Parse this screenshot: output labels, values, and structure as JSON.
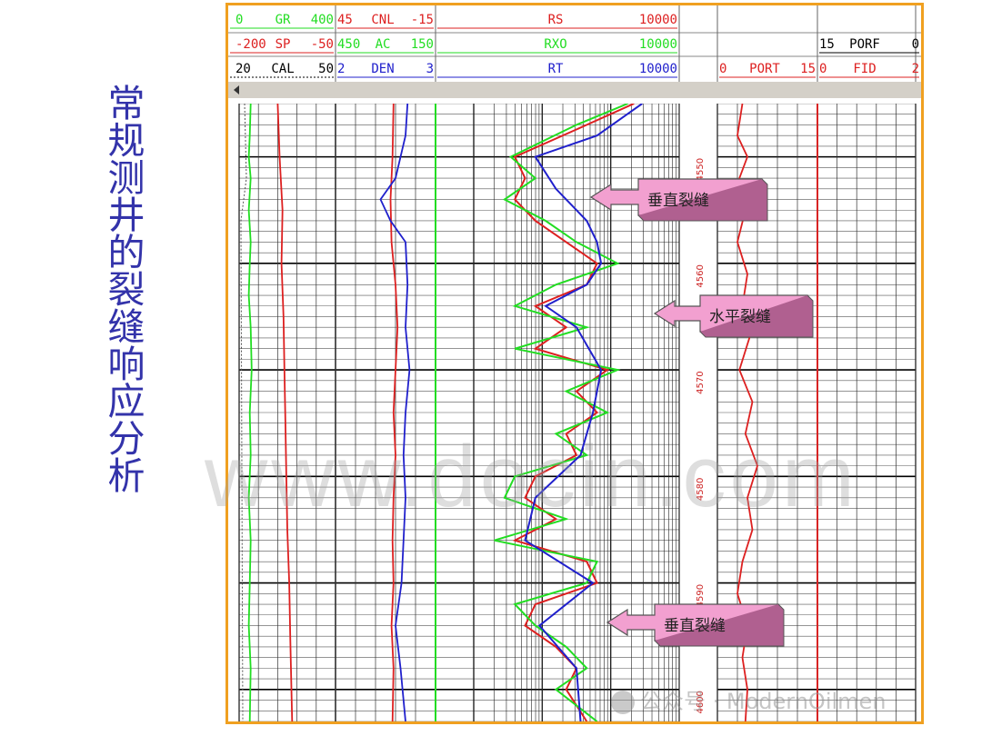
{
  "page_title": "常规测井的裂缝响应分析",
  "watermark": "www.docin.com",
  "credit": "公众号 · ModernOilmen",
  "annotations": [
    {
      "text": "垂直裂缝",
      "depth": 4554
    },
    {
      "text": "水平裂缝",
      "depth": 4565
    },
    {
      "text": "垂直裂缝",
      "depth": 4594
    }
  ],
  "colors": {
    "red": "#dd2020",
    "green": "#22dd22",
    "blue": "#2020cc",
    "frame": "#f0a020",
    "callout_fill": "#f2a0d0",
    "title": "#3333aa"
  },
  "chart_data": {
    "type": "line",
    "depth_range": [
      4545,
      4603
    ],
    "depth_ticks": [
      "4550",
      "4560",
      "4570",
      "4580",
      "4590",
      "4600"
    ],
    "header": {
      "track1": [
        {
          "left": "0",
          "name": "GR",
          "right": "400",
          "color": "#22dd22"
        },
        {
          "left": "-200",
          "name": "SP",
          "right": "-50",
          "color": "#dd2020"
        },
        {
          "left": "20",
          "name": "CAL",
          "right": "50",
          "color": "#000000"
        }
      ],
      "track2": [
        {
          "left": "45",
          "name": "CNL",
          "right": "-15",
          "color": "#dd2020"
        },
        {
          "left": "450",
          "name": "AC",
          "right": "150",
          "color": "#22dd22"
        },
        {
          "left": "2",
          "name": "DEN",
          "right": "3",
          "color": "#2020cc"
        }
      ],
      "track3": [
        {
          "left": "",
          "name": "RS",
          "right": "10000",
          "color": "#dd2020"
        },
        {
          "left": "",
          "name": "RXO",
          "right": "10000",
          "color": "#22dd22"
        },
        {
          "left": "",
          "name": "RT",
          "right": "10000",
          "color": "#2020cc"
        }
      ],
      "track4": [
        {
          "left": "0",
          "name": "PORT",
          "right": "15",
          "color": "#dd2020"
        }
      ],
      "track5": [
        {
          "left": "15",
          "name": "PORF",
          "right": "0",
          "color": "#000000"
        },
        {
          "left": "0",
          "name": "FID",
          "right": "2",
          "color": "#dd2020"
        }
      ]
    },
    "series": [
      {
        "name": "GR",
        "color": "#22dd22",
        "track": 1,
        "values": [
          [
            4545,
            0.12
          ],
          [
            4548,
            0.11
          ],
          [
            4550,
            0.1
          ],
          [
            4552,
            0.12
          ],
          [
            4555,
            0.1
          ],
          [
            4558,
            0.12
          ],
          [
            4560,
            0.11
          ],
          [
            4563,
            0.1
          ],
          [
            4566,
            0.12
          ],
          [
            4570,
            0.13
          ],
          [
            4574,
            0.11
          ],
          [
            4578,
            0.12
          ],
          [
            4582,
            0.1
          ],
          [
            4586,
            0.12
          ],
          [
            4590,
            0.11
          ],
          [
            4594,
            0.1
          ],
          [
            4598,
            0.12
          ],
          [
            4603,
            0.11
          ]
        ]
      },
      {
        "name": "SP",
        "color": "#dd2020",
        "track": 1,
        "values": [
          [
            4545,
            0.4
          ],
          [
            4550,
            0.42
          ],
          [
            4555,
            0.45
          ],
          [
            4560,
            0.44
          ],
          [
            4565,
            0.46
          ],
          [
            4570,
            0.47
          ],
          [
            4575,
            0.48
          ],
          [
            4580,
            0.49
          ],
          [
            4585,
            0.5
          ],
          [
            4590,
            0.52
          ],
          [
            4595,
            0.53
          ],
          [
            4603,
            0.55
          ]
        ]
      },
      {
        "name": "CNL",
        "color": "#dd2020",
        "track": 2,
        "values": [
          [
            4545,
            0.58
          ],
          [
            4550,
            0.57
          ],
          [
            4554,
            0.55
          ],
          [
            4558,
            0.56
          ],
          [
            4562,
            0.6
          ],
          [
            4566,
            0.62
          ],
          [
            4570,
            0.6
          ],
          [
            4574,
            0.58
          ],
          [
            4578,
            0.6
          ],
          [
            4582,
            0.58
          ],
          [
            4586,
            0.57
          ],
          [
            4590,
            0.58
          ],
          [
            4594,
            0.56
          ],
          [
            4598,
            0.58
          ],
          [
            4603,
            0.57
          ]
        ]
      },
      {
        "name": "DEN",
        "color": "#2020cc",
        "track": 2,
        "values": [
          [
            4545,
            0.72
          ],
          [
            4548,
            0.7
          ],
          [
            4552,
            0.6
          ],
          [
            4554,
            0.45
          ],
          [
            4556,
            0.55
          ],
          [
            4558,
            0.7
          ],
          [
            4562,
            0.72
          ],
          [
            4566,
            0.7
          ],
          [
            4570,
            0.74
          ],
          [
            4574,
            0.7
          ],
          [
            4578,
            0.68
          ],
          [
            4582,
            0.7
          ],
          [
            4586,
            0.68
          ],
          [
            4590,
            0.66
          ],
          [
            4594,
            0.6
          ],
          [
            4598,
            0.65
          ],
          [
            4603,
            0.7
          ]
        ]
      },
      {
        "name": "RS",
        "color": "#dd2020",
        "track": 3,
        "values": [
          [
            4545,
            0.78
          ],
          [
            4547,
            0.55
          ],
          [
            4550,
            0.2
          ],
          [
            4552,
            0.25
          ],
          [
            4554,
            0.2
          ],
          [
            4556,
            0.3
          ],
          [
            4558,
            0.45
          ],
          [
            4560,
            0.6
          ],
          [
            4562,
            0.55
          ],
          [
            4564,
            0.3
          ],
          [
            4566,
            0.45
          ],
          [
            4568,
            0.3
          ],
          [
            4570,
            0.65
          ],
          [
            4572,
            0.5
          ],
          [
            4574,
            0.6
          ],
          [
            4576,
            0.45
          ],
          [
            4578,
            0.5
          ],
          [
            4580,
            0.3
          ],
          [
            4582,
            0.25
          ],
          [
            4584,
            0.4
          ],
          [
            4586,
            0.2
          ],
          [
            4588,
            0.55
          ],
          [
            4590,
            0.6
          ],
          [
            4592,
            0.3
          ],
          [
            4594,
            0.25
          ],
          [
            4596,
            0.4
          ],
          [
            4598,
            0.5
          ],
          [
            4600,
            0.45
          ],
          [
            4603,
            0.55
          ]
        ]
      },
      {
        "name": "RXO",
        "color": "#22dd22",
        "track": 3,
        "values": [
          [
            4545,
            0.75
          ],
          [
            4547,
            0.5
          ],
          [
            4550,
            0.18
          ],
          [
            4552,
            0.3
          ],
          [
            4554,
            0.15
          ],
          [
            4556,
            0.35
          ],
          [
            4558,
            0.5
          ],
          [
            4560,
            0.7
          ],
          [
            4562,
            0.4
          ],
          [
            4564,
            0.2
          ],
          [
            4566,
            0.55
          ],
          [
            4568,
            0.2
          ],
          [
            4570,
            0.7
          ],
          [
            4572,
            0.45
          ],
          [
            4574,
            0.65
          ],
          [
            4576,
            0.4
          ],
          [
            4578,
            0.55
          ],
          [
            4580,
            0.2
          ],
          [
            4582,
            0.15
          ],
          [
            4584,
            0.45
          ],
          [
            4586,
            0.1
          ],
          [
            4588,
            0.6
          ],
          [
            4590,
            0.55
          ],
          [
            4592,
            0.2
          ],
          [
            4594,
            0.3
          ],
          [
            4596,
            0.45
          ],
          [
            4598,
            0.55
          ],
          [
            4600,
            0.4
          ],
          [
            4603,
            0.6
          ]
        ]
      },
      {
        "name": "RT",
        "color": "#2020cc",
        "track": 3,
        "values": [
          [
            4545,
            0.82
          ],
          [
            4548,
            0.6
          ],
          [
            4550,
            0.3
          ],
          [
            4553,
            0.4
          ],
          [
            4556,
            0.55
          ],
          [
            4558,
            0.6
          ],
          [
            4560,
            0.62
          ],
          [
            4562,
            0.55
          ],
          [
            4564,
            0.35
          ],
          [
            4566,
            0.5
          ],
          [
            4570,
            0.62
          ],
          [
            4574,
            0.58
          ],
          [
            4578,
            0.52
          ],
          [
            4582,
            0.3
          ],
          [
            4586,
            0.25
          ],
          [
            4590,
            0.58
          ],
          [
            4594,
            0.32
          ],
          [
            4598,
            0.5
          ],
          [
            4603,
            0.52
          ]
        ]
      },
      {
        "name": "PORT",
        "color": "#dd2020",
        "track": 4,
        "values": [
          [
            4545,
            0.25
          ],
          [
            4548,
            0.2
          ],
          [
            4550,
            0.3
          ],
          [
            4552,
            0.22
          ],
          [
            4555,
            0.28
          ],
          [
            4558,
            0.2
          ],
          [
            4561,
            0.3
          ],
          [
            4564,
            0.25
          ],
          [
            4567,
            0.32
          ],
          [
            4570,
            0.22
          ],
          [
            4573,
            0.35
          ],
          [
            4576,
            0.28
          ],
          [
            4579,
            0.4
          ],
          [
            4582,
            0.3
          ],
          [
            4585,
            0.35
          ],
          [
            4588,
            0.25
          ],
          [
            4591,
            0.2
          ],
          [
            4594,
            0.3
          ],
          [
            4597,
            0.25
          ],
          [
            4600,
            0.3
          ],
          [
            4603,
            0.28
          ]
        ]
      },
      {
        "name": "FID",
        "color": "#dd2020",
        "track": 5,
        "values": [
          [
            4545,
            0.0
          ],
          [
            4603,
            0.0
          ]
        ]
      }
    ]
  }
}
